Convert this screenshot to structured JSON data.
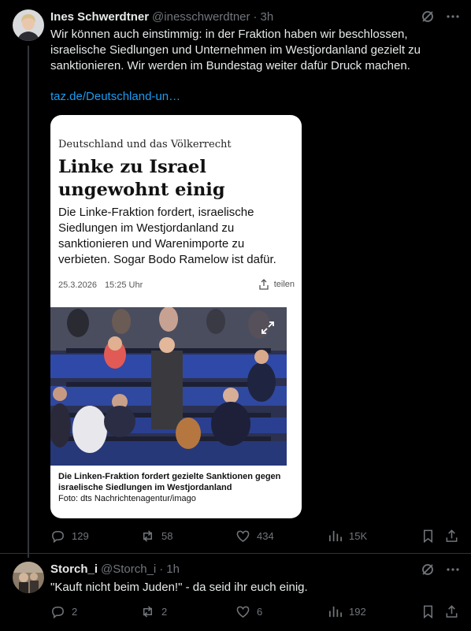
{
  "tweet1": {
    "name": "Ines Schwerdtner",
    "handle": "@inesschwerdtner",
    "separator": "·",
    "time": "3h",
    "text": "Wir können auch einstimmig: in der Fraktion haben wir beschlossen, israelische Siedlungen und Unternehmen im Westjordanland gezielt zu sanktionieren. Wir werden im Bundestag weiter dafür Druck machen.",
    "link": "taz.de/Deutschland-un…",
    "card": {
      "kicker": "Deutschland und das Völkerrecht",
      "headline": "Linke zu Israel ungewohnt einig",
      "teaser": "Die Linke-Fraktion fordert, israelische Siedlungen im Westjordanland zu sanktionieren und Warenimporte zu verbieten. Sogar Bodo Ramelow ist dafür.",
      "date": "25.3.2026",
      "time": "15:25 Uhr",
      "share_label": "teilen",
      "caption": "Die Linken-Fraktion fordert gezielte Sanktionen gegen israelische Siedlungen im Westjordanland",
      "credit": "Foto: dts Nachrichtenagentur/imago"
    },
    "actions": {
      "replies": "129",
      "reposts": "58",
      "likes": "434",
      "views": "15K"
    }
  },
  "tweet2": {
    "name": "Storch_i",
    "handle": "@Storch_i",
    "separator": "·",
    "time": "1h",
    "text": "\"Kauft nicht beim Juden!\" - da seid ihr euch einig.",
    "actions": {
      "replies": "2",
      "reposts": "2",
      "likes": "6",
      "views": "192"
    }
  },
  "icons": [
    "grok-icon",
    "more-icon",
    "reply-icon",
    "repost-icon",
    "like-icon",
    "views-icon",
    "bookmark-icon",
    "share-icon",
    "expand-icon"
  ]
}
